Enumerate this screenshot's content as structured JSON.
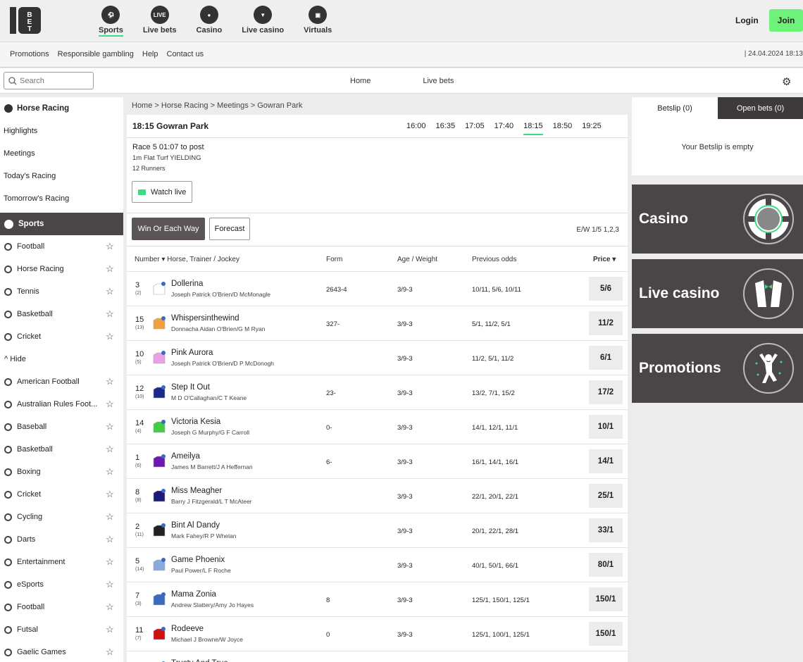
{
  "brand": {
    "logo_text": "10BET",
    "accent_color": "#3ddc84",
    "join_color": "#6ff27a"
  },
  "topnav": [
    {
      "label": "Sports",
      "icon": "soccer-ball-icon",
      "active": true
    },
    {
      "label": "Live bets",
      "icon": "live-icon",
      "icon_text": "LIVE"
    },
    {
      "label": "Casino",
      "icon": "casino-chip-icon"
    },
    {
      "label": "Live casino",
      "icon": "tuxedo-icon"
    },
    {
      "label": "Virtuals",
      "icon": "virtual-tv-icon"
    }
  ],
  "auth": {
    "login": "Login",
    "join": "Join"
  },
  "sublinks": [
    "Promotions",
    "Responsible gambling",
    "Help",
    "Contact us"
  ],
  "datetime": "| 24.04.2024 18:13",
  "search": {
    "placeholder": "Search"
  },
  "center_nav": [
    "Home",
    "Live bets"
  ],
  "sidebar": {
    "racing_header": "Horse Racing",
    "racing_links": [
      "Highlights",
      "Meetings",
      "Today's Racing",
      "Tomorrow's Racing"
    ],
    "sports_header": "Sports",
    "top_sports": [
      "Football",
      "Horse Racing",
      "Tennis",
      "Basketball",
      "Cricket"
    ],
    "hide_label": "^ Hide",
    "all_sports": [
      "American Football",
      "Australian Rules Foot...",
      "Baseball",
      "Basketball",
      "Boxing",
      "Cricket",
      "Cycling",
      "Darts",
      "Entertainment",
      "eSports",
      "Football",
      "Futsal",
      "Gaelic Games"
    ]
  },
  "breadcrumb": "Home > Horse Racing > Meetings > Gowran Park",
  "race": {
    "title": "18:15 Gowran Park",
    "times": [
      "16:00",
      "16:35",
      "17:05",
      "17:40",
      "18:15",
      "18:50",
      "19:25"
    ],
    "active_time": "18:15",
    "info1": "Race 5  01:07 to post",
    "info2": "1m  Flat  Turf  YIELDING",
    "info3": "12 Runners",
    "watch": "Watch live",
    "tab_win": "Win Or Each Way",
    "tab_forecast": "Forecast",
    "ew": "E/W 1/5 1,2,3"
  },
  "columns": {
    "number": "Number ▾ Horse, Trainer / Jockey",
    "form": "Form",
    "age": "Age / Weight",
    "prev": "Previous odds",
    "price": "Price ▾"
  },
  "runners": [
    {
      "num": "3",
      "draw": "(2)",
      "horse": "Dollerina",
      "tj": "Joseph Patrick O'Brien/D McMonagle",
      "form": "2643-4",
      "age": "3/9-3",
      "prev": "10/11, 5/6, 10/11",
      "price": "5/6",
      "silk": "#ffffff"
    },
    {
      "num": "15",
      "draw": "(13)",
      "horse": "Whispersinthewind",
      "tj": "Donnacha Aidan O'Brien/G M Ryan",
      "form": "327-",
      "age": "3/9-3",
      "prev": "5/1, 11/2, 5/1",
      "price": "11/2",
      "silk": "#f0a040"
    },
    {
      "num": "10",
      "draw": "(5)",
      "horse": "Pink Aurora",
      "tj": "Joseph Patrick O'Brien/D P McDonogh",
      "form": "",
      "age": "3/9-3",
      "prev": "11/2, 5/1, 11/2",
      "price": "6/1",
      "silk": "#e8a0e8"
    },
    {
      "num": "12",
      "draw": "(10)",
      "horse": "Step It Out",
      "tj": "M D O'Callaghan/C T Keane",
      "form": "23-",
      "age": "3/9-3",
      "prev": "13/2, 7/1, 15/2",
      "price": "17/2",
      "silk": "#1a2a8a"
    },
    {
      "num": "14",
      "draw": "(4)",
      "horse": "Victoria Kesia",
      "tj": "Joseph G Murphy/G F Carroll",
      "form": "0-",
      "age": "3/9-3",
      "prev": "14/1, 12/1, 11/1",
      "price": "10/1",
      "silk": "#44cc44"
    },
    {
      "num": "1",
      "draw": "(6)",
      "horse": "Ameilya",
      "tj": "James M Barrett/J A Heffernan",
      "form": "6-",
      "age": "3/9-3",
      "prev": "16/1, 14/1, 16/1",
      "price": "14/1",
      "silk": "#6a1ab0"
    },
    {
      "num": "8",
      "draw": "(8)",
      "horse": "Miss Meagher",
      "tj": "Barry J Fitzgerald/L T McAteer",
      "form": "",
      "age": "3/9-3",
      "prev": "22/1, 20/1, 22/1",
      "price": "25/1",
      "silk": "#1a1a7a"
    },
    {
      "num": "2",
      "draw": "(11)",
      "horse": "Bint Al Dandy",
      "tj": "Mark Fahey/R P Whelan",
      "form": "",
      "age": "3/9-3",
      "prev": "20/1, 22/1, 28/1",
      "price": "33/1",
      "silk": "#222222"
    },
    {
      "num": "5",
      "draw": "(14)",
      "horse": "Game Phoenix",
      "tj": "Paul Power/L F Roche",
      "form": "",
      "age": "3/9-3",
      "prev": "40/1, 50/1, 66/1",
      "price": "80/1",
      "silk": "#88aadd"
    },
    {
      "num": "7",
      "draw": "(3)",
      "horse": "Mama Zonia",
      "tj": "Andrew Slattery/Amy Jo Hayes",
      "form": "8",
      "age": "3/9-3",
      "prev": "125/1, 150/1, 125/1",
      "price": "150/1",
      "silk": "#3a6ac0"
    },
    {
      "num": "11",
      "draw": "(7)",
      "horse": "Rodeeve",
      "tj": "Michael J Browne/W Joyce",
      "form": "0",
      "age": "3/9-3",
      "prev": "125/1, 100/1, 125/1",
      "price": "150/1",
      "silk": "#cc1111"
    },
    {
      "num": "",
      "draw": "",
      "horse": "Trusty And True",
      "tj": "",
      "form": "",
      "age": "",
      "prev": "",
      "price": "",
      "silk": "#ffffff"
    }
  ],
  "betslip": {
    "tab1": "Betslip (0)",
    "tab2": "Open bets (0)",
    "empty": "Your Betslip is empty"
  },
  "promos": [
    {
      "label": "Casino",
      "icon": "casino-chip-icon"
    },
    {
      "label": "Live casino",
      "icon": "tuxedo-icon"
    },
    {
      "label": "Promotions",
      "icon": "celebrating-person-icon"
    }
  ]
}
